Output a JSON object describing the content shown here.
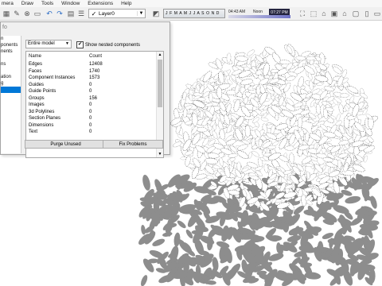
{
  "menu": [
    "mera",
    "Draw",
    "Tools",
    "Window",
    "Extensions",
    "Help"
  ],
  "toolbar": {
    "layer_value": "Layer0",
    "months": "J F M A M J J A S O N D",
    "time_start": "04:43 AM",
    "time_noon": "Noon",
    "time_end": "07:27 PM"
  },
  "panel": {
    "title": "fo",
    "tree_items": [
      "n",
      "ponents",
      "nents",
      "",
      "ns",
      "",
      "ation",
      "g",
      ""
    ],
    "selected_index": 8,
    "scope_select": "Entire model",
    "nested_label": "Show nested components",
    "nested_checked": "✔",
    "columns": {
      "name": "Name",
      "count": "Count"
    },
    "stats": [
      {
        "name": "Edges",
        "count": "12408"
      },
      {
        "name": "Faces",
        "count": "1740"
      },
      {
        "name": "Component Instances",
        "count": "1573"
      },
      {
        "name": "Guides",
        "count": "0"
      },
      {
        "name": "Guide Points",
        "count": "0"
      },
      {
        "name": "Groups",
        "count": "156"
      },
      {
        "name": "Images",
        "count": "0"
      },
      {
        "name": "3d Polylines",
        "count": "0"
      },
      {
        "name": "Section Planes",
        "count": "0"
      },
      {
        "name": "Dimensions",
        "count": "0"
      },
      {
        "name": "Text",
        "count": "0"
      }
    ],
    "purge_label": "Purge Unused",
    "fix_label": "Fix Problems"
  }
}
